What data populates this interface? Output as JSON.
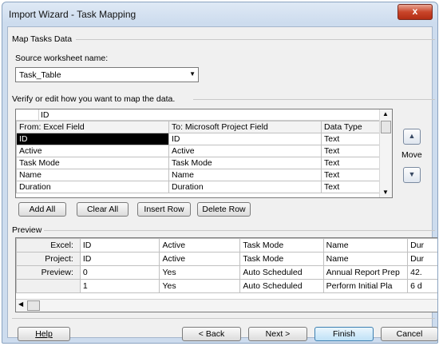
{
  "window": {
    "title": "Import Wizard - Task Mapping",
    "close_symbol": "x"
  },
  "section_title": "Map Tasks Data",
  "source": {
    "label": "Source worksheet name:",
    "value": "Task_Table"
  },
  "verify_label": "Verify or edit how you want to map the data.",
  "mapping": {
    "edit_value": "ID",
    "headers": [
      "From: Excel Field",
      "To:  Microsoft Project Field",
      "Data Type"
    ],
    "rows": [
      [
        "ID",
        "ID",
        "Text"
      ],
      [
        "Active",
        "Active",
        "Text"
      ],
      [
        "Task Mode",
        "Task Mode",
        "Text"
      ],
      [
        "Name",
        "Name",
        "Text"
      ],
      [
        "Duration",
        "Duration",
        "Text"
      ]
    ],
    "selected_row": 0
  },
  "move_label": "Move",
  "buttons": {
    "add_all": "Add All",
    "clear_all": "Clear All",
    "insert_row": "Insert Row",
    "delete_row": "Delete Row"
  },
  "preview": {
    "label": "Preview",
    "row_labels": [
      "Excel:",
      "Project:",
      "Preview:"
    ],
    "excel": [
      "ID",
      "Active",
      "Task Mode",
      "Name",
      "Dur"
    ],
    "project": [
      "ID",
      "Active",
      "Task Mode",
      "Name",
      "Dur"
    ],
    "data": [
      [
        "0",
        "Yes",
        "Auto Scheduled",
        "Annual Report Prep",
        "42."
      ],
      [
        "1",
        "Yes",
        "Auto Scheduled",
        "Perform Initial Pla",
        "6 d"
      ]
    ]
  },
  "footer": {
    "help": "Help",
    "back": "< Back",
    "next": "Next >",
    "finish": "Finish",
    "cancel": "Cancel"
  }
}
